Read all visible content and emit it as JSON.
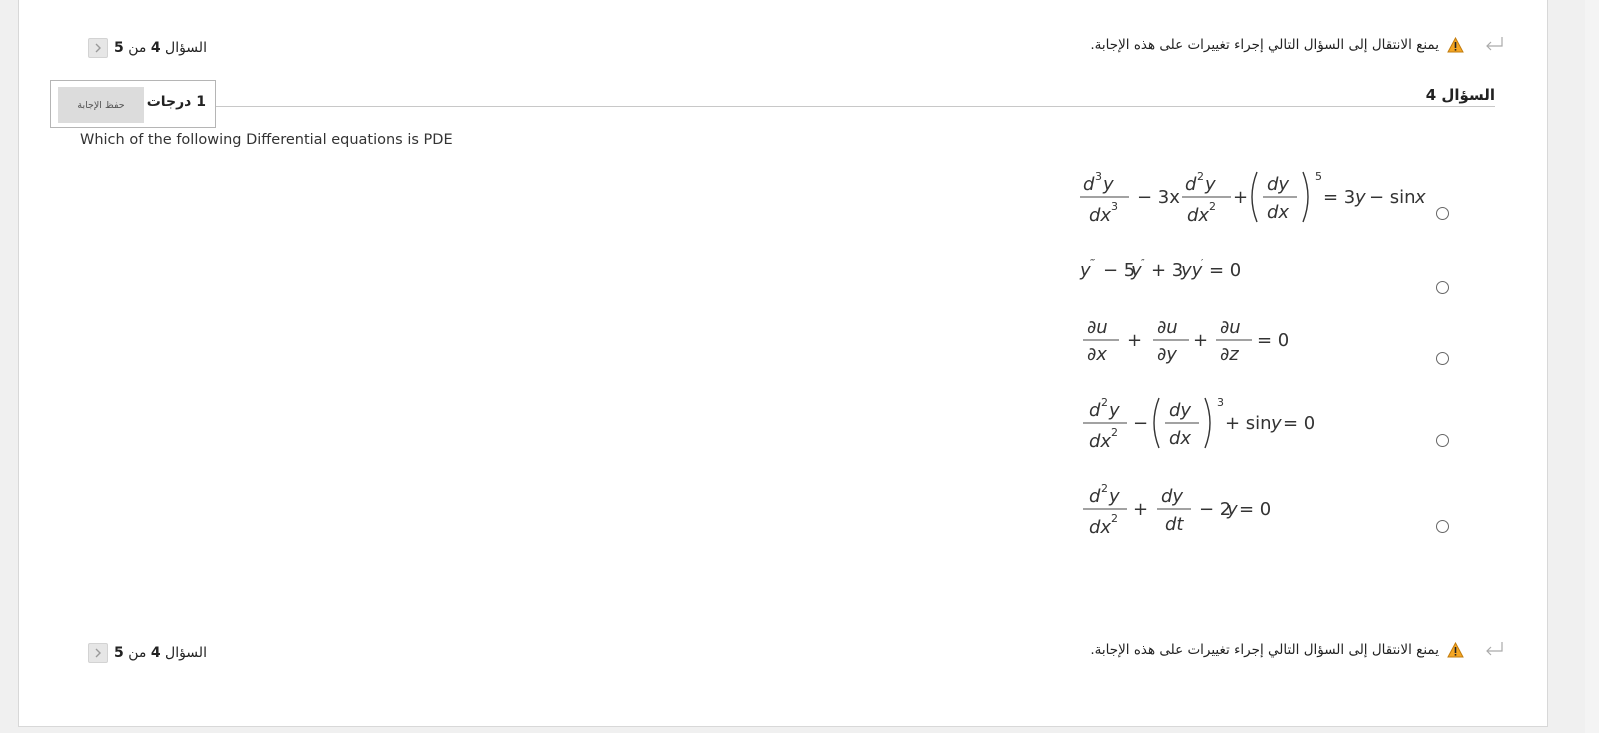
{
  "navigation": {
    "counter_prefix": "السؤال",
    "current": "4",
    "of_word": "من",
    "total": "5"
  },
  "warning": {
    "text": "يمنع الانتقال إلى السؤال التالي إجراء تغييرات على هذه الإجابة."
  },
  "question": {
    "title": "السؤال 4",
    "points_label": "1 درجات",
    "save_label": "حفظ الإجابة",
    "text": "Which of the following Differential equations is PDE"
  },
  "options": [
    {
      "id": "a",
      "equation": "d³y/dx³ − 3x·d²y/dx² + (dy/dx)⁵ = 3y − sin x",
      "selected": false
    },
    {
      "id": "b",
      "equation": "y‴ − 5y″ + 3yy′ = 0",
      "selected": false
    },
    {
      "id": "c",
      "equation": "∂u/∂x + ∂u/∂y + ∂u/∂z = 0",
      "selected": false
    },
    {
      "id": "d",
      "equation": "d²y/dx² − (dy/dx)³ + sin y = 0",
      "selected": false
    },
    {
      "id": "e",
      "equation": "d²y/dx² + dy/dt − 2y = 0",
      "selected": false
    }
  ],
  "icons": {
    "warning": "warning-triangle-icon",
    "return": "return-arrow-icon",
    "nav": "chevron-right-icon"
  },
  "colors": {
    "warning_fill": "#f5a623",
    "background": "#f0f0f0",
    "card": "#ffffff",
    "save_button": "#dcdcdc"
  }
}
